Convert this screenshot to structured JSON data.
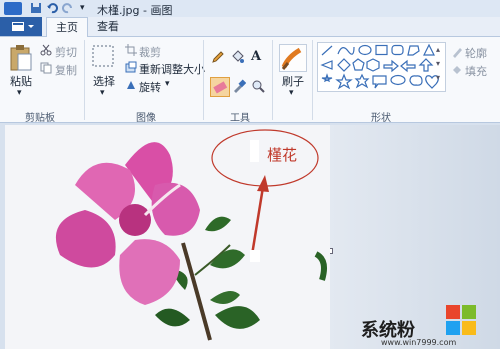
{
  "window": {
    "title": "木槿.jpg - 画图"
  },
  "tabs": {
    "home": "主页",
    "view": "查看"
  },
  "clipboard": {
    "paste": "粘贴",
    "cut": "剪切",
    "copy": "复制",
    "group": "剪贴板"
  },
  "image": {
    "select": "选择",
    "crop": "裁剪",
    "resize": "重新调整大小",
    "rotate": "旋转",
    "group": "图像"
  },
  "tools": {
    "group": "工具",
    "text_tool": "A"
  },
  "brushes": {
    "label": "刷子"
  },
  "shapes": {
    "group": "形状",
    "outline": "轮廓",
    "fill": "填充"
  },
  "canvas": {
    "annotation_text": "槿花"
  },
  "watermark": {
    "brand": "系统粉",
    "url": "www.win7999.com"
  },
  "colors": {
    "accent": "#2b5fa8",
    "annotation": "#c0392b",
    "flower": "#d94fa6"
  }
}
